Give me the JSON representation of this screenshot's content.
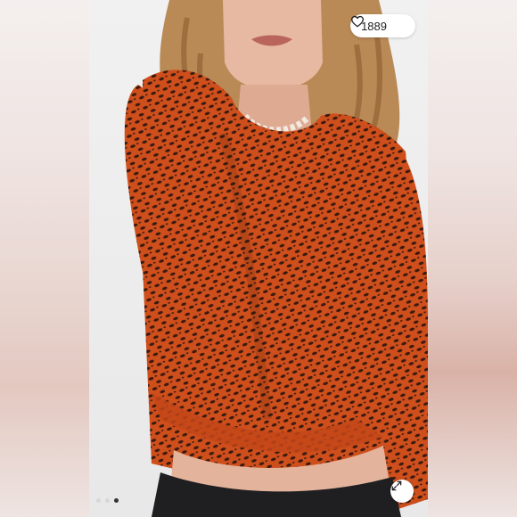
{
  "listing": {
    "like_count": "1889",
    "heart_icon": "heart-outline-icon",
    "expand_icon": "expand-arrows-icon",
    "carousel": {
      "total": 3,
      "active_index": 2
    }
  },
  "colors": {
    "pill_background": "#ffffff",
    "top_orange": "#c8481a",
    "top_dark_pattern": "#3a1a10",
    "dot_active": "#333333",
    "dot_inactive": "#d7d7d7"
  }
}
